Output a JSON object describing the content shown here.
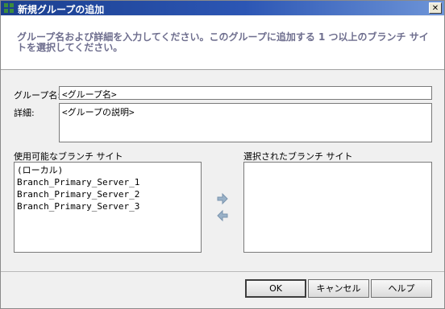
{
  "window": {
    "title": "新規グループの追加",
    "close_glyph": "✕"
  },
  "banner": {
    "instruction": "グループ名および詳細を入力してください。このグループに追加する 1 つ以上のブランチ サイトを選択してください。"
  },
  "form": {
    "group_name_label": "グループ名:",
    "group_name_value": "<グループ名>",
    "details_label": "詳細:",
    "details_value": "<グループの説明>"
  },
  "available_sites": {
    "label": "使用可能なブランチ サイト",
    "items": [
      "(ローカル)",
      "Branch_Primary_Server_1",
      "Branch_Primary_Server_2",
      "Branch_Primary_Server_3"
    ]
  },
  "selected_sites": {
    "label": "選択されたブランチ サイト",
    "items": []
  },
  "buttons": {
    "ok": "OK",
    "cancel": "キャンセル",
    "help": "ヘルプ"
  },
  "icons": {
    "add": "arrow-right-icon",
    "remove": "arrow-left-icon",
    "app": "app-icon"
  },
  "colors": {
    "title_bar": "#2c56b4",
    "banner_text": "#6e6e8e",
    "arrow": "#9ab2c8"
  }
}
